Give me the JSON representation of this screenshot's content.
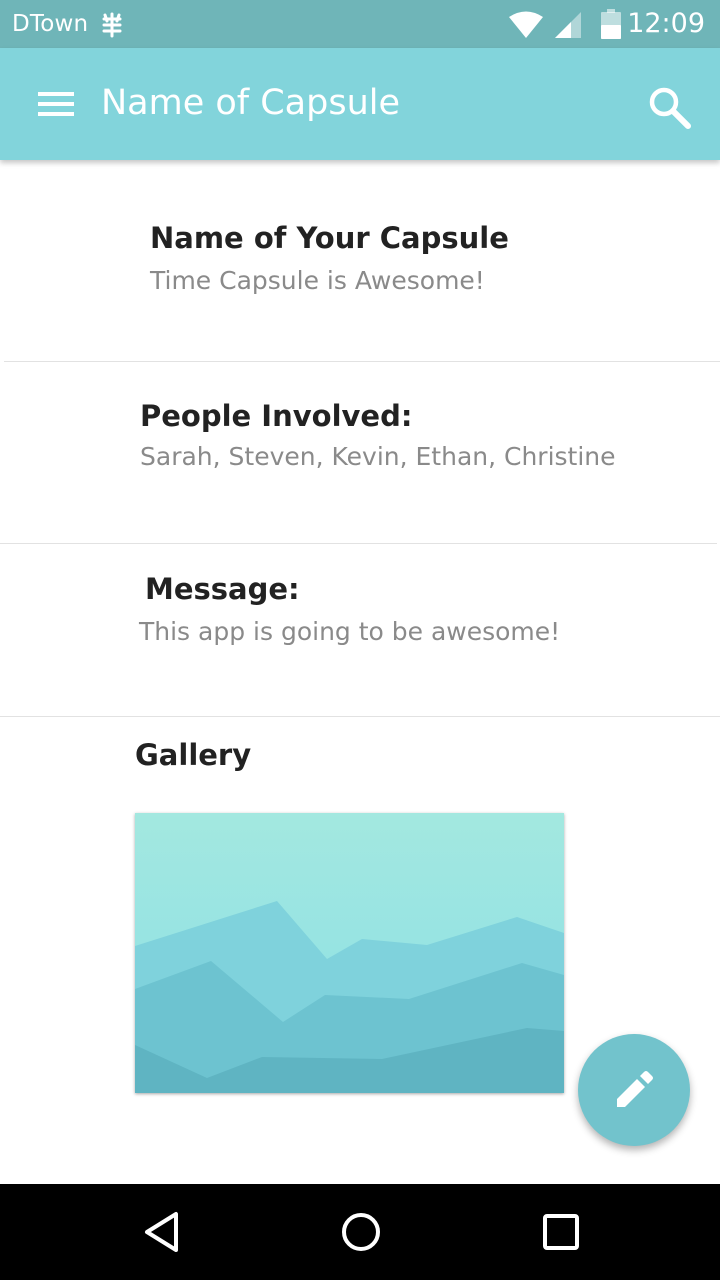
{
  "status_bar": {
    "carrier": "DTown",
    "time": "12:09",
    "carrier_icon": "carrier-roaming-icon",
    "icons": [
      "wifi-icon",
      "cell-signal-icon",
      "battery-icon"
    ]
  },
  "app_bar": {
    "title": "Name of Capsule",
    "menu_icon": "hamburger-menu-icon",
    "search_icon": "search-icon",
    "color": "#82d4db"
  },
  "capsule": {
    "name_label": "Name of Your Capsule",
    "name_value": "Time Capsule is Awesome!",
    "people_label": "People Involved:",
    "people_value": "Sarah, Steven, Kevin, Ethan, Christine",
    "message_label": "Message:",
    "message_value": "This app is going to be awesome!",
    "gallery_label": "Gallery"
  },
  "fab": {
    "icon": "edit-pencil-icon",
    "color": "#72c3cc"
  },
  "nav_bar": {
    "icons": [
      "back-icon",
      "home-icon",
      "recents-icon"
    ]
  }
}
